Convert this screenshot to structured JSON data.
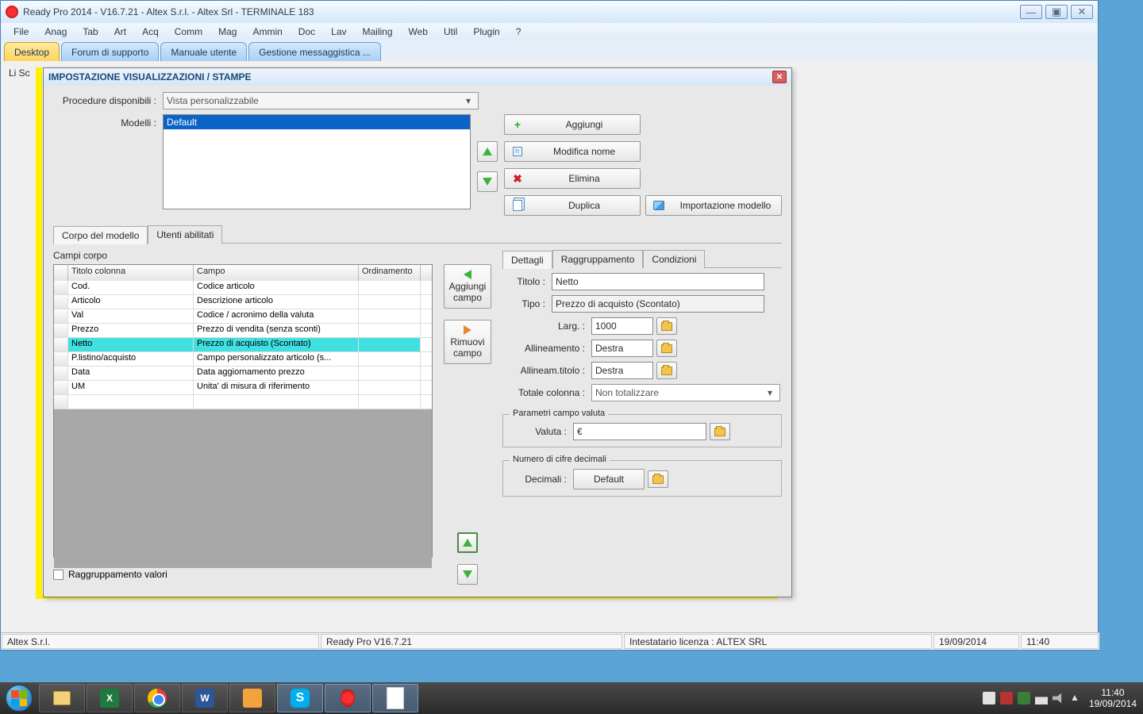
{
  "titlebar": {
    "title": "Ready Pro 2014 - V16.7.21 - Altex S.r.l. - Altex Srl - TERMINALE 183"
  },
  "menubar": [
    "File",
    "Anag",
    "Tab",
    "Art",
    "Acq",
    "Comm",
    "Mag",
    "Ammin",
    "Doc",
    "Lav",
    "Mailing",
    "Web",
    "Util",
    "Plugin",
    "?"
  ],
  "maintabs": [
    "Desktop",
    "Forum di supporto",
    "Manuale utente",
    "Gestione messaggistica ..."
  ],
  "bgwin": "Li  Sc",
  "dialog": {
    "title": "IMPOSTAZIONE VISUALIZZAZIONI / STAMPE",
    "procedure_label": "Procedure disponibili :",
    "procedure_value": "Vista personalizzabile",
    "modelli_label": "Modelli :",
    "modelli_selected": "Default",
    "btn_aggiungi": "Aggiungi",
    "btn_modifica": "Modifica nome",
    "btn_elimina": "Elimina",
    "btn_duplica": "Duplica",
    "btn_importa": "Importazione modello",
    "inner_tabs": [
      "Corpo del modello",
      "Utenti abilitati"
    ],
    "campi_corpo_label": "Campi corpo",
    "grid_headers": [
      "",
      "Titolo colonna",
      "Campo",
      "Ordinamento"
    ],
    "grid_rows": [
      {
        "titolo": "Cod.",
        "campo": "Codice articolo",
        "ord": ""
      },
      {
        "titolo": "Articolo",
        "campo": "Descrizione articolo",
        "ord": ""
      },
      {
        "titolo": "Val",
        "campo": "Codice / acronimo della valuta",
        "ord": ""
      },
      {
        "titolo": "Prezzo",
        "campo": "Prezzo di vendita (senza sconti)",
        "ord": ""
      },
      {
        "titolo": "Netto",
        "campo": "Prezzo di acquisto (Scontato)",
        "ord": "",
        "selected": true
      },
      {
        "titolo": "P.listino/acquisto",
        "campo": "Campo personalizzato articolo (s...",
        "ord": ""
      },
      {
        "titolo": "Data",
        "campo": "Data aggiornamento prezzo",
        "ord": ""
      },
      {
        "titolo": "UM",
        "campo": "Unita' di misura di riferimento",
        "ord": ""
      }
    ],
    "btn_aggiungi_campo": "Aggiungi campo",
    "btn_rimuovi_campo": "Rimuovi campo",
    "raggruppamento_valori": "Raggruppamento valori",
    "detail_tabs": [
      "Dettagli",
      "Raggruppamento",
      "Condizioni"
    ],
    "details": {
      "titolo_lbl": "Titolo :",
      "titolo_val": "Netto",
      "tipo_lbl": "Tipo :",
      "tipo_val": "Prezzo di acquisto (Scontato)",
      "larg_lbl": "Larg. :",
      "larg_val": "1000",
      "allin_lbl": "Allineamento :",
      "allin_val": "Destra",
      "allin_tit_lbl": "Allineam.titolo :",
      "allin_tit_val": "Destra",
      "totale_lbl": "Totale colonna :",
      "totale_val": "Non totalizzare",
      "valuta_fieldset": "Parametri campo valuta",
      "valuta_lbl": "Valuta :",
      "valuta_val": "€",
      "decimali_fieldset": "Numero di cifre decimali",
      "decimali_lbl": "Decimali :",
      "decimali_val": "Default"
    }
  },
  "statusbar": {
    "c1": "Altex S.r.l.",
    "c2": "Ready Pro V16.7.21",
    "c3": "Intestatario licenza : ALTEX SRL",
    "c4": "19/09/2014",
    "c5": "11:40"
  },
  "taskbar": {
    "time": "11:40",
    "date": "19/09/2014"
  }
}
